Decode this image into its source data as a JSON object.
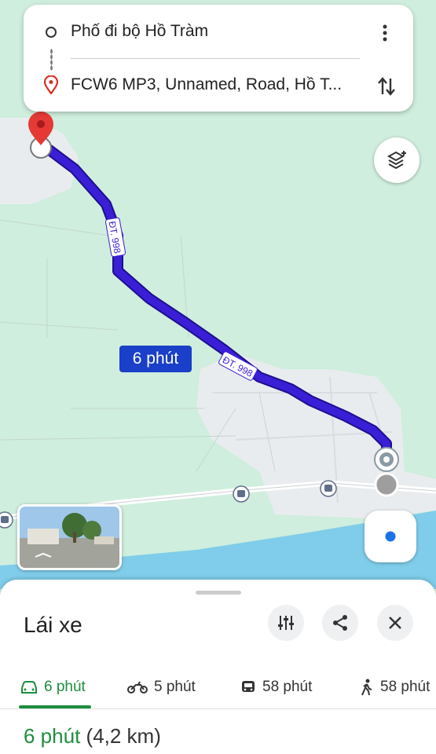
{
  "search": {
    "origin": "Phố đi bộ Hồ Tràm",
    "destination": "FCW6 MP3, Unnamed, Road, Hồ T..."
  },
  "map": {
    "route_time_label": "6 phút",
    "road_label_1": "ĐT. 998",
    "road_label_2": "ĐT. 998",
    "icons": [
      "destination-pin-icon",
      "origin-marker-icon",
      "layers-icon",
      "locate-icon",
      "bus-stop-icon"
    ]
  },
  "sheet": {
    "mode_title": "Lái xe",
    "tabs": [
      {
        "icon": "car-icon",
        "label": "6 phút",
        "active": true
      },
      {
        "icon": "motorbike-icon",
        "label": "5 phút",
        "active": false
      },
      {
        "icon": "transit-icon",
        "label": "58 phút",
        "active": false
      },
      {
        "icon": "walk-icon",
        "label": "58 phút",
        "active": false
      }
    ],
    "summary_duration": "6 phút",
    "summary_distance": "(4,2 km)"
  },
  "colors": {
    "route": "#3a1fd6",
    "accent_green": "#1e8e3e",
    "map_green": "#cfeedd",
    "water": "#7fcdea",
    "time_label": "#1a3fc8"
  }
}
